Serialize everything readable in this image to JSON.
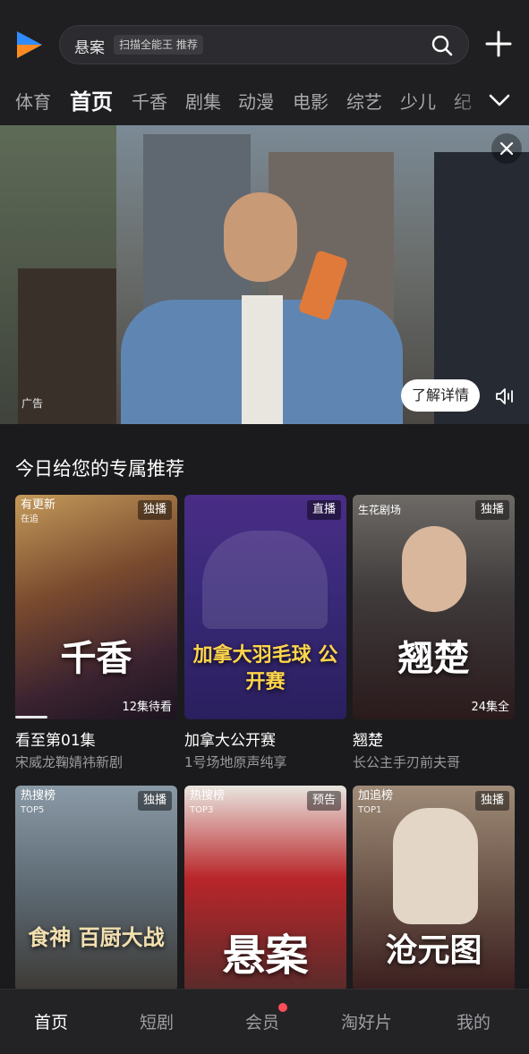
{
  "search": {
    "text": "悬案",
    "tag": "扫描全能王 推荐"
  },
  "tabs": [
    "体育",
    "首页",
    "千香",
    "剧集",
    "动漫",
    "电影",
    "综艺",
    "少儿",
    "纪"
  ],
  "banner": {
    "ad_label": "广告",
    "detail_button": "了解详情"
  },
  "section_title": "今日给您的专属推荐",
  "row1": [
    {
      "badge_left": "有更新",
      "badge_left_sub": "在追",
      "badge_right": "独播",
      "poster_text": "千香",
      "episodes": "12集待看",
      "title": "看至第01集",
      "subtitle": "宋威龙鞠婧祎新剧"
    },
    {
      "badge_right": "直播",
      "poster_text": "加拿大羽毛球 公开赛",
      "title": "加拿大公开赛",
      "subtitle": "1号场地原声纯享"
    },
    {
      "studio": "生花剧场",
      "badge_right": "独播",
      "poster_text": "翘楚",
      "episodes": "24集全",
      "title": "翘楚",
      "subtitle": "长公主手刃前夫哥"
    }
  ],
  "row2": [
    {
      "badge_left": "热搜榜",
      "badge_left_sub": "TOP5",
      "badge_right": "独播",
      "poster_text": "食神 百厨大战"
    },
    {
      "badge_left": "热搜榜",
      "badge_left_sub": "TOP3",
      "badge_right": "预告",
      "poster_text": "悬案"
    },
    {
      "badge_left": "加追榜",
      "badge_left_sub": "TOP1",
      "badge_right": "独播",
      "poster_text": "沧元图"
    }
  ],
  "bottom_nav": [
    "首页",
    "短剧",
    "会员",
    "淘好片",
    "我的"
  ],
  "colors": {
    "accent_blue": "#2f8cff",
    "accent_orange": "#ff8a1f",
    "notify_red": "#ff4d5a"
  },
  "icons": [
    "app-logo-icon",
    "search-icon",
    "plus-icon",
    "chevron-down-icon",
    "close-icon",
    "speaker-mute-icon"
  ]
}
